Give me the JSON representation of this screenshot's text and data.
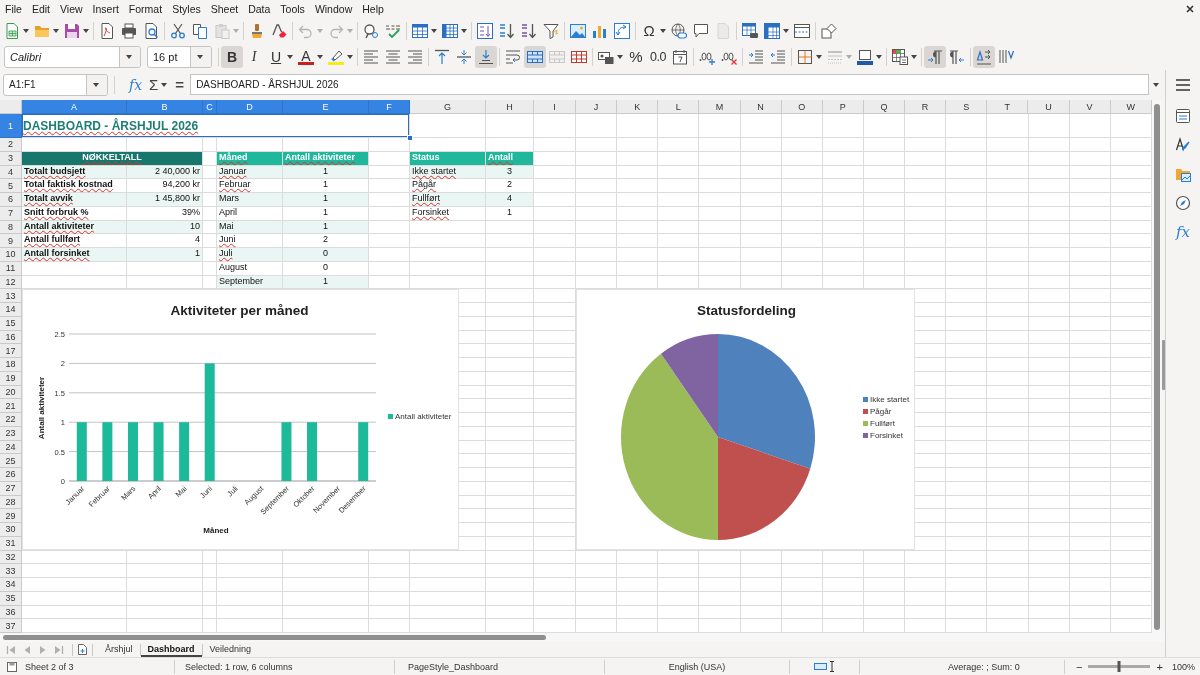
{
  "menu_bar": {
    "items": [
      "File",
      "Edit",
      "View",
      "Insert",
      "Format",
      "Styles",
      "Sheet",
      "Data",
      "Tools",
      "Window",
      "Help"
    ]
  },
  "standard_toolbar": {
    "groups": [
      [
        {
          "kind": "new",
          "menu": true,
          "disabled": false
        },
        {
          "kind": "open",
          "menu": true,
          "disabled": false
        },
        {
          "kind": "save",
          "menu": true,
          "disabled": false
        }
      ],
      [
        {
          "kind": "export_pdf",
          "menu": false,
          "disabled": false
        },
        {
          "kind": "print",
          "menu": false,
          "disabled": false
        },
        {
          "kind": "print_preview",
          "menu": false,
          "disabled": false
        }
      ],
      [
        {
          "kind": "cut",
          "menu": false,
          "disabled": false
        },
        {
          "kind": "copy",
          "menu": false,
          "disabled": false
        },
        {
          "kind": "paste",
          "menu": true,
          "disabled": true
        }
      ],
      [
        {
          "kind": "clone_formatting",
          "menu": false,
          "disabled": false
        },
        {
          "kind": "clear_formatting",
          "menu": false,
          "disabled": false
        }
      ],
      [
        {
          "kind": "undo",
          "menu": true,
          "disabled": true
        },
        {
          "kind": "redo",
          "menu": true,
          "disabled": true
        }
      ],
      [
        {
          "kind": "find_replace",
          "menu": false,
          "disabled": false
        },
        {
          "kind": "spelling",
          "menu": false,
          "disabled": false
        }
      ],
      [
        {
          "kind": "rows",
          "menu": true,
          "disabled": false
        },
        {
          "kind": "columns",
          "menu": true,
          "disabled": false
        }
      ],
      [
        {
          "kind": "sort",
          "menu": false,
          "disabled": false
        },
        {
          "kind": "sort_ascending",
          "menu": false,
          "disabled": false
        },
        {
          "kind": "sort_descending",
          "menu": false,
          "disabled": false
        },
        {
          "kind": "autofilter",
          "menu": false,
          "disabled": false
        }
      ],
      [
        {
          "kind": "image",
          "menu": false,
          "disabled": false
        },
        {
          "kind": "chart",
          "menu": false,
          "disabled": false
        },
        {
          "kind": "pivot_table",
          "menu": false,
          "disabled": false
        }
      ],
      [
        {
          "kind": "special_character",
          "label": "Ω",
          "menu": true,
          "disabled": false
        },
        {
          "kind": "hyperlink",
          "menu": false,
          "disabled": false
        },
        {
          "kind": "comment",
          "menu": false,
          "disabled": false
        },
        {
          "kind": "headers_footers",
          "menu": false,
          "disabled": true
        }
      ],
      [
        {
          "kind": "print_area",
          "menu": false,
          "disabled": false
        },
        {
          "kind": "freeze",
          "menu": true,
          "disabled": false
        },
        {
          "kind": "split_window",
          "menu": false,
          "disabled": false
        }
      ],
      [
        {
          "kind": "shapes",
          "menu": false,
          "disabled": false
        }
      ]
    ]
  },
  "formatting_toolbar": {
    "font_name": "Calibri",
    "font_size": "16 pt",
    "groups": [
      [
        {
          "kind": "bold",
          "label": "B",
          "menu": false,
          "pressed": true,
          "disabled": false
        },
        {
          "kind": "italic",
          "label": "I",
          "menu": false,
          "pressed": false,
          "disabled": false
        },
        {
          "kind": "underline",
          "label": "U",
          "menu": true,
          "pressed": false,
          "disabled": false
        },
        {
          "kind": "font_color",
          "label": "A",
          "menu": true,
          "pressed": false,
          "disabled": false
        },
        {
          "kind": "highlight",
          "menu": true,
          "pressed": false,
          "disabled": false
        }
      ],
      [
        {
          "kind": "align_left",
          "menu": false,
          "pressed": false,
          "disabled": false
        },
        {
          "kind": "align_center",
          "menu": false,
          "pressed": false,
          "disabled": false
        },
        {
          "kind": "align_right",
          "menu": false,
          "pressed": false,
          "disabled": false
        }
      ],
      [
        {
          "kind": "align_top",
          "menu": false,
          "pressed": false,
          "disabled": false
        },
        {
          "kind": "align_middle",
          "menu": false,
          "pressed": false,
          "disabled": false
        },
        {
          "kind": "align_bottom",
          "menu": false,
          "pressed": true,
          "disabled": false
        }
      ],
      [
        {
          "kind": "wrap_text",
          "menu": false,
          "pressed": false,
          "disabled": false
        },
        {
          "kind": "merge_center",
          "menu": false,
          "pressed": true,
          "disabled": false
        },
        {
          "kind": "merge_cells",
          "menu": false,
          "pressed": false,
          "disabled": true
        },
        {
          "kind": "unmerge_cells",
          "menu": false,
          "pressed": false,
          "disabled": false
        }
      ],
      [
        {
          "kind": "number_format",
          "menu": true,
          "pressed": false,
          "disabled": false
        },
        {
          "kind": "percent",
          "label": "%",
          "menu": false,
          "pressed": false,
          "disabled": false
        },
        {
          "kind": "standard",
          "label": "0.0",
          "menu": false,
          "pressed": false,
          "disabled": false
        },
        {
          "kind": "date",
          "menu": false,
          "pressed": false,
          "disabled": false
        }
      ],
      [
        {
          "kind": "add_decimal",
          "menu": false,
          "pressed": false,
          "disabled": false
        },
        {
          "kind": "delete_decimal",
          "menu": false,
          "pressed": false,
          "disabled": false
        }
      ],
      [
        {
          "kind": "increase_indent",
          "menu": false,
          "pressed": false,
          "disabled": false
        },
        {
          "kind": "decrease_indent",
          "menu": false,
          "pressed": false,
          "disabled": false
        }
      ],
      [
        {
          "kind": "borders",
          "menu": true,
          "pressed": false,
          "disabled": false
        },
        {
          "kind": "border_style",
          "menu": true,
          "pressed": false,
          "disabled": true
        },
        {
          "kind": "border_color",
          "menu": true,
          "pressed": false,
          "disabled": false
        }
      ],
      [
        {
          "kind": "conditional",
          "menu": true,
          "pressed": false,
          "disabled": false
        }
      ],
      [
        {
          "kind": "left_to_right",
          "menu": false,
          "pressed": true,
          "disabled": false
        },
        {
          "kind": "right_to_left",
          "menu": false,
          "pressed": false,
          "disabled": false
        }
      ],
      [
        {
          "kind": "text_direction",
          "menu": false,
          "pressed": true,
          "disabled": false
        },
        {
          "kind": "vertical_text",
          "menu": false,
          "pressed": false,
          "disabled": false
        }
      ]
    ]
  },
  "formula_bar": {
    "name_box": "A1:F1",
    "function_wizard": "fx",
    "sum": "Σ",
    "equals": "=",
    "formula": "DASHBOARD - ÅRSHJUL 2026"
  },
  "sheet": {
    "columns": [
      {
        "label": "A",
        "selected": true
      },
      {
        "label": "B",
        "selected": true
      },
      {
        "label": "C",
        "selected": true
      },
      {
        "label": "D",
        "selected": true
      },
      {
        "label": "E",
        "selected": true
      },
      {
        "label": "F",
        "selected": true
      },
      {
        "label": "G",
        "selected": false
      },
      {
        "label": "H",
        "selected": false
      },
      {
        "label": "I",
        "selected": false
      },
      {
        "label": "J",
        "selected": false
      },
      {
        "label": "K",
        "selected": false
      },
      {
        "label": "L",
        "selected": false
      },
      {
        "label": "M",
        "selected": false
      },
      {
        "label": "N",
        "selected": false
      },
      {
        "label": "O",
        "selected": false
      },
      {
        "label": "P",
        "selected": false
      },
      {
        "label": "Q",
        "selected": false
      },
      {
        "label": "R",
        "selected": false
      },
      {
        "label": "S",
        "selected": false
      },
      {
        "label": "T",
        "selected": false
      },
      {
        "label": "U",
        "selected": false
      },
      {
        "label": "V",
        "selected": false
      },
      {
        "label": "W",
        "selected": false
      }
    ],
    "rows": [
      {
        "label": "1",
        "selected": true
      },
      {
        "label": "2",
        "selected": false
      },
      {
        "label": "3",
        "selected": false
      },
      {
        "label": "4",
        "selected": false
      },
      {
        "label": "5",
        "selected": false
      },
      {
        "label": "6",
        "selected": false
      },
      {
        "label": "7",
        "selected": false
      },
      {
        "label": "8",
        "selected": false
      },
      {
        "label": "9",
        "selected": false
      },
      {
        "label": "10",
        "selected": false
      },
      {
        "label": "11",
        "selected": false
      },
      {
        "label": "12",
        "selected": false
      },
      {
        "label": "13",
        "selected": false
      },
      {
        "label": "14",
        "selected": false
      },
      {
        "label": "15",
        "selected": false
      },
      {
        "label": "16",
        "selected": false
      },
      {
        "label": "17",
        "selected": false
      },
      {
        "label": "18",
        "selected": false
      },
      {
        "label": "19",
        "selected": false
      },
      {
        "label": "20",
        "selected": false
      },
      {
        "label": "21",
        "selected": false
      },
      {
        "label": "22",
        "selected": false
      },
      {
        "label": "23",
        "selected": false
      },
      {
        "label": "24",
        "selected": false
      },
      {
        "label": "25",
        "selected": false
      },
      {
        "label": "26",
        "selected": false
      },
      {
        "label": "27",
        "selected": false
      },
      {
        "label": "28",
        "selected": false
      },
      {
        "label": "29",
        "selected": false
      },
      {
        "label": "30",
        "selected": false
      },
      {
        "label": "31",
        "selected": false
      },
      {
        "label": "32",
        "selected": false
      },
      {
        "label": "33",
        "selected": false
      },
      {
        "label": "34",
        "selected": false
      },
      {
        "label": "35",
        "selected": false
      },
      {
        "label": "36",
        "selected": false
      },
      {
        "label": "37",
        "selected": false
      }
    ],
    "title": {
      "text": "DASHBOARD - ÅRSHJUL 2026",
      "selected": true,
      "spell_flagged": true
    },
    "key_figures": {
      "heading": {
        "text": "NØKKELTALL",
        "spell_flagged": true
      },
      "rows": [
        {
          "shaded": true,
          "cells": [
            {
              "text": "Totalt budsjett",
              "spell_flagged": true
            },
            {
              "text": "2 40,000 kr",
              "spell_flagged": false
            }
          ]
        },
        {
          "shaded": false,
          "cells": [
            {
              "text": "Total faktisk kostnad",
              "spell_flagged": true
            },
            {
              "text": "94,200 kr",
              "spell_flagged": false
            }
          ]
        },
        {
          "shaded": true,
          "cells": [
            {
              "text": "Totalt avvik",
              "spell_flagged": true
            },
            {
              "text": "1 45,800 kr",
              "spell_flagged": false
            }
          ]
        },
        {
          "shaded": false,
          "cells": [
            {
              "text": "Snitt forbruk %",
              "spell_flagged": true
            },
            {
              "text": "39%",
              "spell_flagged": false
            }
          ]
        },
        {
          "shaded": true,
          "cells": [
            {
              "text": "Antall aktiviteter",
              "spell_flagged": true
            },
            {
              "text": "10",
              "spell_flagged": false
            }
          ]
        },
        {
          "shaded": false,
          "cells": [
            {
              "text": "Antall fullført",
              "spell_flagged": true
            },
            {
              "text": "4",
              "spell_flagged": false
            }
          ]
        },
        {
          "shaded": true,
          "cells": [
            {
              "text": "Antall forsinket",
              "spell_flagged": true
            },
            {
              "text": "1",
              "spell_flagged": false
            }
          ]
        }
      ]
    },
    "month_table": {
      "header": [
        {
          "text": "Måned",
          "spell_flagged": true
        },
        {
          "text": "Antall aktiviteter",
          "spell_flagged": true
        }
      ],
      "rows": [
        {
          "shaded": true,
          "cells": [
            {
              "text": "Januar",
              "spell_flagged": true
            },
            {
              "text": "1",
              "spell_flagged": false
            }
          ]
        },
        {
          "shaded": false,
          "cells": [
            {
              "text": "Februar",
              "spell_flagged": true
            },
            {
              "text": "1",
              "spell_flagged": false
            }
          ]
        },
        {
          "shaded": true,
          "cells": [
            {
              "text": "Mars",
              "spell_flagged": false
            },
            {
              "text": "1",
              "spell_flagged": false
            }
          ]
        },
        {
          "shaded": false,
          "cells": [
            {
              "text": "April",
              "spell_flagged": false
            },
            {
              "text": "1",
              "spell_flagged": false
            }
          ]
        },
        {
          "shaded": true,
          "cells": [
            {
              "text": "Mai",
              "spell_flagged": false
            },
            {
              "text": "1",
              "spell_flagged": false
            }
          ]
        },
        {
          "shaded": false,
          "cells": [
            {
              "text": "Juni",
              "spell_flagged": true
            },
            {
              "text": "2",
              "spell_flagged": false
            }
          ]
        },
        {
          "shaded": true,
          "cells": [
            {
              "text": "Juli",
              "spell_flagged": true
            },
            {
              "text": "0",
              "spell_flagged": false
            }
          ]
        },
        {
          "shaded": false,
          "cells": [
            {
              "text": "August",
              "spell_flagged": false
            },
            {
              "text": "0",
              "spell_flagged": false
            }
          ]
        },
        {
          "shaded": true,
          "cells": [
            {
              "text": "September",
              "spell_flagged": false
            },
            {
              "text": "1",
              "spell_flagged": false
            }
          ]
        }
      ]
    },
    "status_table": {
      "header": [
        {
          "text": "Status",
          "spell_flagged": false
        },
        {
          "text": "Antall",
          "spell_flagged": true
        }
      ],
      "rows": [
        {
          "shaded": true,
          "cells": [
            {
              "text": "Ikke startet",
              "spell_flagged": true
            },
            {
              "text": "3",
              "spell_flagged": false
            }
          ]
        },
        {
          "shaded": false,
          "cells": [
            {
              "text": "Pågår",
              "spell_flagged": true
            },
            {
              "text": "2",
              "spell_flagged": false
            }
          ]
        },
        {
          "shaded": true,
          "cells": [
            {
              "text": "Fullført",
              "spell_flagged": true
            },
            {
              "text": "4",
              "spell_flagged": false
            }
          ]
        },
        {
          "shaded": false,
          "cells": [
            {
              "text": "Forsinket",
              "spell_flagged": true
            },
            {
              "text": "1",
              "spell_flagged": false
            }
          ]
        }
      ]
    },
    "charts": [
      {
        "chart_data": {
          "type": "bar",
          "title": "Aktiviteter per måned",
          "xlabel": "Måned",
          "ylabel": "Antall aktiviteter",
          "categories": [
            "Januar",
            "Februar",
            "Mars",
            "April",
            "Mai",
            "Juni",
            "Juli",
            "August",
            "September",
            "Oktober",
            "November",
            "Desember"
          ],
          "series": [
            {
              "name": "Antall aktiviteter",
              "color": "#1db99b",
              "values": [
                1,
                1,
                1,
                1,
                1,
                2,
                0,
                0,
                1,
                1,
                0,
                1
              ]
            }
          ],
          "ylim": [
            0,
            2.5
          ],
          "yticks": [
            0,
            0.5,
            1,
            1.5,
            2,
            2.5
          ],
          "grid": true,
          "legend": "right"
        }
      },
      {
        "chart_data": {
          "type": "pie",
          "title": "Statusfordeling",
          "categories": [
            "Ikke startet",
            "Pågår",
            "Fullført",
            "Forsinket"
          ],
          "series": [
            {
              "values": [
                30,
                20,
                40,
                10
              ]
            }
          ],
          "colors": [
            "#4f81bd",
            "#c0504d",
            "#9bbb59",
            "#8064a2"
          ],
          "legend": "right"
        }
      }
    ]
  },
  "sidebar": {
    "functions": "fx"
  },
  "sheet_tabs": {
    "navigation": [
      {
        "kind": "first",
        "disabled": true
      },
      {
        "kind": "previous",
        "disabled": true
      },
      {
        "kind": "next",
        "disabled": true
      },
      {
        "kind": "last",
        "disabled": true
      }
    ],
    "tabs": [
      {
        "label": "Årshjul",
        "selected": false
      },
      {
        "label": "Dashboard",
        "selected": true
      },
      {
        "label": "Veiledning",
        "selected": false
      }
    ]
  },
  "status_bar": {
    "sheet": "Sheet 2 of 3",
    "selection": "Selected: 1 row, 6 columns",
    "page_style": "PageStyle_Dashboard",
    "language": "English (USA)",
    "statistics": "Average: ; Sum: 0",
    "zoom_out": "−",
    "zoom": {
      "level": 0.5
    },
    "zoom_in": "+",
    "zoom_value": "100%"
  }
}
